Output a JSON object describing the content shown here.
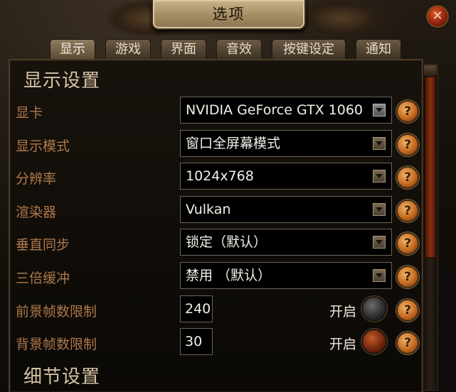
{
  "window": {
    "title": "选项",
    "close_icon": "close-icon"
  },
  "tabs": [
    {
      "label": "显示",
      "active": true
    },
    {
      "label": "游戏"
    },
    {
      "label": "界面"
    },
    {
      "label": "音效"
    },
    {
      "label": "按键设定"
    },
    {
      "label": "通知"
    }
  ],
  "sections": {
    "display": "显示设置",
    "detail": "细节设置"
  },
  "rows": [
    {
      "label": "显卡",
      "value": "NVIDIA GeForce GTX 1060"
    },
    {
      "label": "显示模式",
      "value": "窗口全屏幕模式"
    },
    {
      "label": "分辨率",
      "value": "1024x768"
    },
    {
      "label": "渲染器",
      "value": "Vulkan"
    },
    {
      "label": "垂直同步",
      "value": "锁定（默认）"
    },
    {
      "label": "三倍缓冲",
      "value": "禁用 （默认）"
    },
    {
      "label": "前景帧数限制",
      "value": "240",
      "toggle_label": "开启",
      "toggle_on": false
    },
    {
      "label": "背景帧数限制",
      "value": "30",
      "toggle_label": "开启",
      "toggle_on": true
    }
  ],
  "help_symbol": "?",
  "colors": {
    "label": "#b0794a",
    "accent": "#c46a1f"
  }
}
